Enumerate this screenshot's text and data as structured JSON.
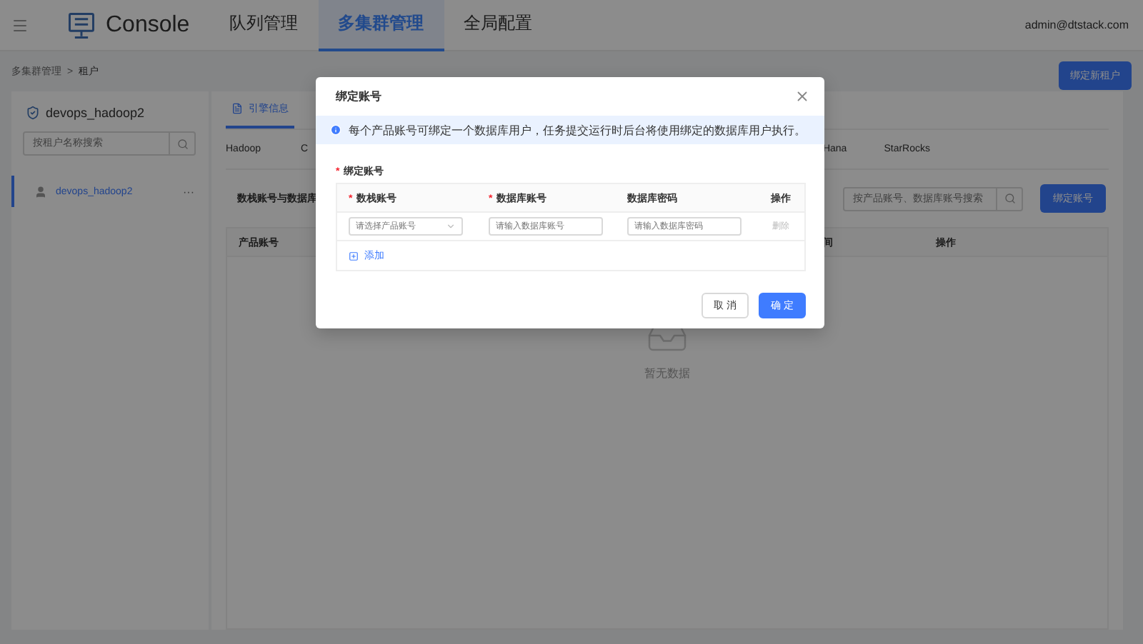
{
  "header": {
    "title": "Console",
    "nav": [
      {
        "label": "队列管理",
        "selected": false
      },
      {
        "label": "多集群管理",
        "selected": true
      },
      {
        "label": "全局配置",
        "selected": false
      }
    ],
    "user": "admin@dtstack.com"
  },
  "breadcrumb": {
    "items": [
      "多集群管理",
      "租户"
    ],
    "separator": ">"
  },
  "top_button": "绑定新租户",
  "sidebar": {
    "title": "devops_hadoop2",
    "search_placeholder": "按租户名称搜索",
    "items": [
      {
        "label": "devops_hadoop2",
        "selected": true,
        "more": "···"
      }
    ]
  },
  "main": {
    "tabs": [
      {
        "label": "引擎信息",
        "selected": true
      }
    ],
    "engines_left": [
      "Hadoop",
      "C"
    ],
    "engines_right": [
      "Hana",
      "StarRocks"
    ],
    "section_title": "数栈账号与数据库",
    "search_placeholder": "按产品账号、数据库账号搜索",
    "bind_button": "绑定账号",
    "columns_left": [
      "产品账号"
    ],
    "columns_right": [
      "间",
      "操作"
    ],
    "empty_text": "暂无数据"
  },
  "modal": {
    "title": "绑定账号",
    "required_mark": "*",
    "field_required": true,
    "alert": "每个产品账号可绑定一个数据库用户，任务提交运行时后台将使用绑定的数据库用户执行。",
    "field_label": "绑定账号",
    "columns": [
      {
        "label": "数栈账号",
        "required": true
      },
      {
        "label": "数据库账号",
        "required": true
      },
      {
        "label": "数据库密码",
        "required": false
      },
      {
        "label": "操作",
        "required": false
      }
    ],
    "row": {
      "product_placeholder": "请选择产品账号",
      "account_placeholder": "请输入数据库账号",
      "password_placeholder": "请输入数据库密码",
      "delete": "删除"
    },
    "add": "添加",
    "cancel": "取 消",
    "ok": "确 定"
  }
}
